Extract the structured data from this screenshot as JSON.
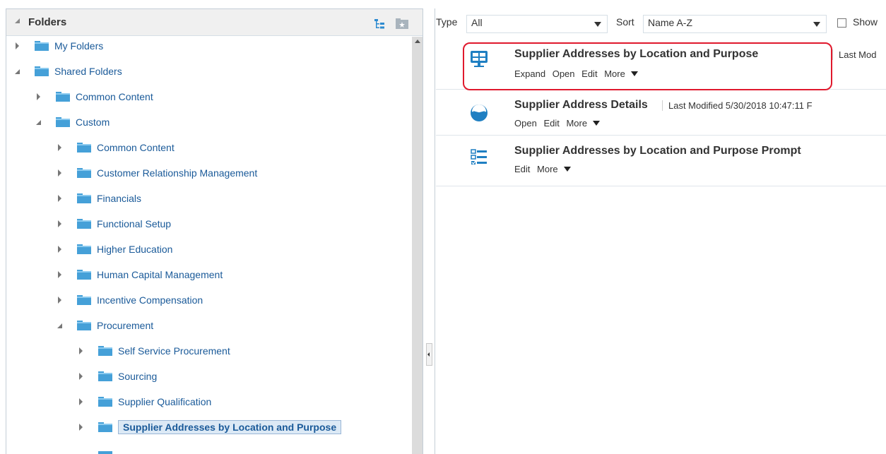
{
  "folders_panel": {
    "title": "Folders",
    "tree": [
      {
        "label": "My Folders",
        "state": "collapsed"
      },
      {
        "label": "Shared Folders",
        "state": "expanded"
      },
      {
        "label": "Common Content",
        "state": "collapsed"
      },
      {
        "label": "Custom",
        "state": "expanded"
      },
      {
        "label": "Common Content",
        "state": "collapsed"
      },
      {
        "label": "Customer Relationship Management",
        "state": "collapsed"
      },
      {
        "label": "Financials",
        "state": "collapsed"
      },
      {
        "label": "Functional Setup",
        "state": "collapsed"
      },
      {
        "label": "Higher Education",
        "state": "collapsed"
      },
      {
        "label": "Human Capital Management",
        "state": "collapsed"
      },
      {
        "label": "Incentive Compensation",
        "state": "collapsed"
      },
      {
        "label": "Procurement",
        "state": "expanded"
      },
      {
        "label": "Self Service Procurement",
        "state": "collapsed"
      },
      {
        "label": "Sourcing",
        "state": "collapsed"
      },
      {
        "label": "Supplier Qualification",
        "state": "collapsed"
      },
      {
        "label": "Supplier Addresses by Location and Purpose",
        "state": "collapsed",
        "selected": true
      }
    ]
  },
  "filters": {
    "type_label": "Type",
    "type_value": "All",
    "sort_label": "Sort",
    "sort_value": "Name A-Z",
    "show_label": "Show"
  },
  "items": [
    {
      "title": "Supplier Addresses by Location and Purpose",
      "meta": "Last Mod",
      "icon": "dashboard-icon",
      "actions": [
        "Expand",
        "Open",
        "Edit"
      ],
      "more": "More",
      "highlighted": true
    },
    {
      "title": "Supplier Address Details",
      "meta": "Last Modified 5/30/2018 10:47:11 F",
      "icon": "analysis-icon",
      "actions": [
        "Open",
        "Edit"
      ],
      "more": "More"
    },
    {
      "title": "Supplier Addresses by Location and Purpose Prompt",
      "meta": "",
      "icon": "prompt-icon",
      "actions": [
        "Edit"
      ],
      "more": "More"
    }
  ],
  "colors": {
    "accent": "#1a5a99",
    "folder": "#45a0d8",
    "highlight_border": "#e0192d",
    "selected_bg": "#dce9f5"
  }
}
